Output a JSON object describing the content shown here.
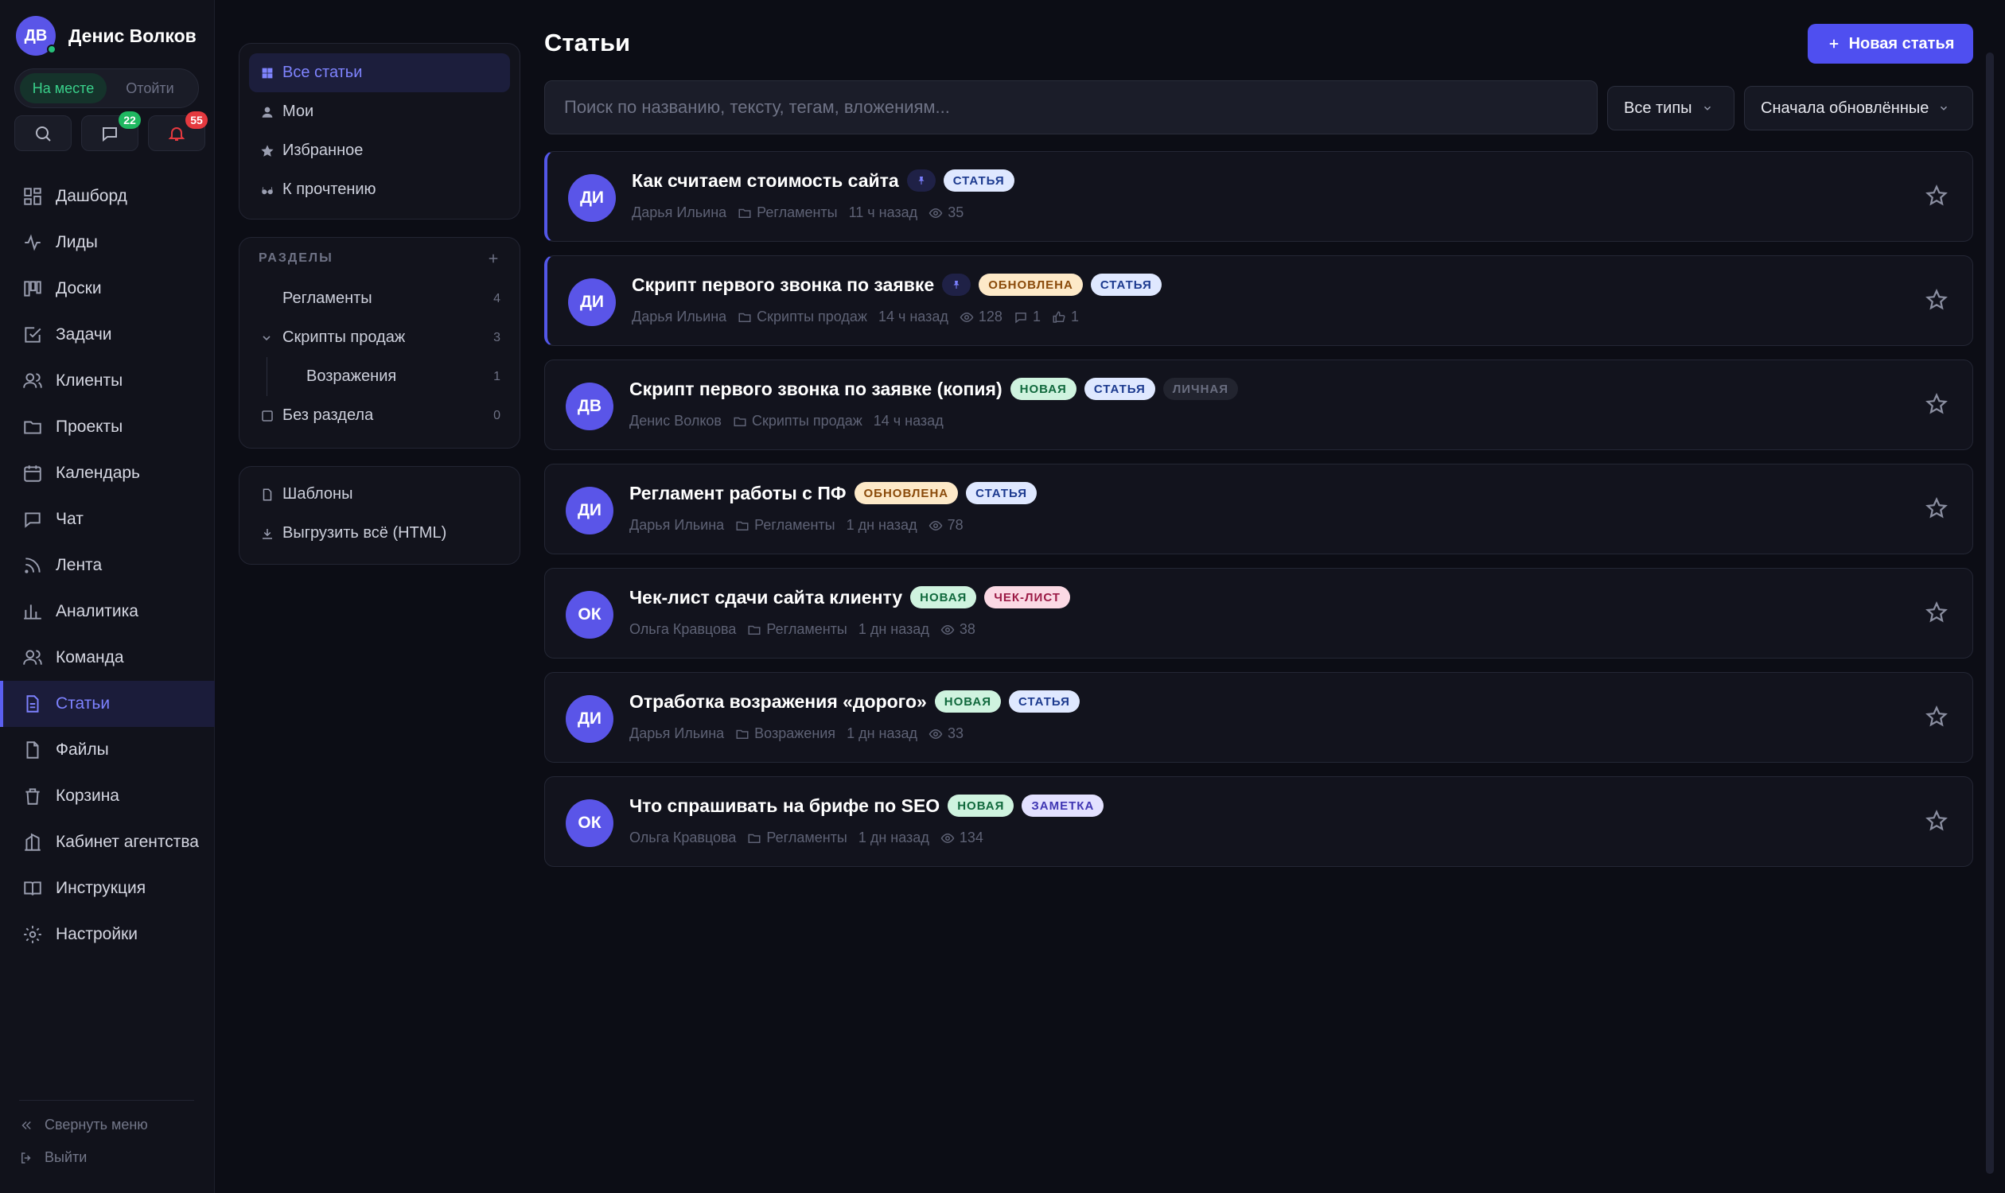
{
  "user": {
    "initials": "ДВ",
    "name": "Денис Волков"
  },
  "status": {
    "present": "На месте",
    "away": "Отойти"
  },
  "quick": {
    "messages_count": "22",
    "notifications_count": "55"
  },
  "nav": [
    {
      "label": "Дашборд",
      "icon": "dashboard-icon"
    },
    {
      "label": "Лиды",
      "icon": "activity-icon"
    },
    {
      "label": "Доски",
      "icon": "board-icon"
    },
    {
      "label": "Задачи",
      "icon": "task-icon"
    },
    {
      "label": "Клиенты",
      "icon": "users-icon"
    },
    {
      "label": "Проекты",
      "icon": "folder-icon"
    },
    {
      "label": "Календарь",
      "icon": "calendar-icon"
    },
    {
      "label": "Чат",
      "icon": "chat-icon"
    },
    {
      "label": "Лента",
      "icon": "feed-icon"
    },
    {
      "label": "Аналитика",
      "icon": "analytics-icon"
    },
    {
      "label": "Команда",
      "icon": "team-icon"
    },
    {
      "label": "Статьи",
      "icon": "document-icon",
      "active": true
    },
    {
      "label": "Файлы",
      "icon": "file-icon"
    },
    {
      "label": "Корзина",
      "icon": "trash-icon"
    },
    {
      "label": "Кабинет агентства",
      "icon": "building-icon"
    },
    {
      "label": "Инструкция",
      "icon": "book-icon"
    },
    {
      "label": "Настройки",
      "icon": "gear-icon"
    }
  ],
  "footer": {
    "collapse": "Свернуть меню",
    "logout": "Выйти"
  },
  "filters": [
    {
      "label": "Все статьи",
      "icon": "grid-icon",
      "active": true
    },
    {
      "label": "Мои",
      "icon": "person-icon"
    },
    {
      "label": "Избранное",
      "icon": "star-icon"
    },
    {
      "label": "К прочтению",
      "icon": "glasses-icon"
    }
  ],
  "sections": {
    "heading": "РАЗДЕЛЫ",
    "items": [
      {
        "label": "Регламенты",
        "count": "4"
      },
      {
        "label": "Скрипты продаж",
        "count": "3"
      },
      {
        "label": "Возражения",
        "count": "1"
      },
      {
        "label": "Без раздела",
        "count": "0"
      }
    ]
  },
  "tools": {
    "templates": "Шаблоны",
    "export": "Выгрузить всё (HTML)"
  },
  "main": {
    "title": "Статьи",
    "new_button": "Новая статья",
    "search_placeholder": "Поиск по названию, тексту, тегам, вложениям...",
    "type_filter": "Все типы",
    "sort": "Сначала обновлённые"
  },
  "articles": [
    {
      "initials": "ДИ",
      "title": "Как считаем стоимость сайта",
      "pinned": true,
      "tags": [
        {
          "t": "СТАТЬЯ",
          "k": "art"
        }
      ],
      "author": "Дарья Ильина",
      "section": "Регламенты",
      "time": "11 ч назад",
      "views": "35"
    },
    {
      "initials": "ДИ",
      "title": "Скрипт первого звонка по заявке",
      "pinned": true,
      "tags": [
        {
          "t": "ОБНОВЛЕНА",
          "k": "upd"
        },
        {
          "t": "СТАТЬЯ",
          "k": "art"
        }
      ],
      "author": "Дарья Ильина",
      "section": "Скрипты продаж",
      "time": "14 ч назад",
      "views": "128",
      "comments": "1",
      "likes": "1"
    },
    {
      "initials": "ДВ",
      "title": "Скрипт первого звонка по заявке (копия)",
      "tags": [
        {
          "t": "НОВАЯ",
          "k": "new"
        },
        {
          "t": "СТАТЬЯ",
          "k": "art"
        },
        {
          "t": "ЛИЧНАЯ",
          "k": "priv"
        }
      ],
      "author": "Денис Волков",
      "section": "Скрипты продаж",
      "time": "14 ч назад"
    },
    {
      "initials": "ДИ",
      "title": "Регламент работы с ПФ",
      "tags": [
        {
          "t": "ОБНОВЛЕНА",
          "k": "upd"
        },
        {
          "t": "СТАТЬЯ",
          "k": "art"
        }
      ],
      "author": "Дарья Ильина",
      "section": "Регламенты",
      "time": "1 дн назад",
      "views": "78"
    },
    {
      "initials": "ОК",
      "title": "Чек-лист сдачи сайта клиенту",
      "tags": [
        {
          "t": "НОВАЯ",
          "k": "new"
        },
        {
          "t": "ЧЕК-ЛИСТ",
          "k": "chk"
        }
      ],
      "author": "Ольга Кравцова",
      "section": "Регламенты",
      "time": "1 дн назад",
      "views": "38"
    },
    {
      "initials": "ДИ",
      "title": "Отработка возражения «дорого»",
      "tags": [
        {
          "t": "НОВАЯ",
          "k": "new"
        },
        {
          "t": "СТАТЬЯ",
          "k": "art"
        }
      ],
      "author": "Дарья Ильина",
      "section": "Возражения",
      "time": "1 дн назад",
      "views": "33"
    },
    {
      "initials": "ОК",
      "title": "Что спрашивать на брифе по SEO",
      "tags": [
        {
          "t": "НОВАЯ",
          "k": "new"
        },
        {
          "t": "ЗАМЕТКА",
          "k": "note"
        }
      ],
      "author": "Ольга Кравцова",
      "section": "Регламенты",
      "time": "1 дн назад",
      "views": "134"
    }
  ],
  "colors": {
    "accent": "#4f4ff0",
    "bg": "#0c0d15",
    "online": "#27c07a",
    "badge_green": "#1fb861",
    "badge_red": "#e5393f"
  }
}
